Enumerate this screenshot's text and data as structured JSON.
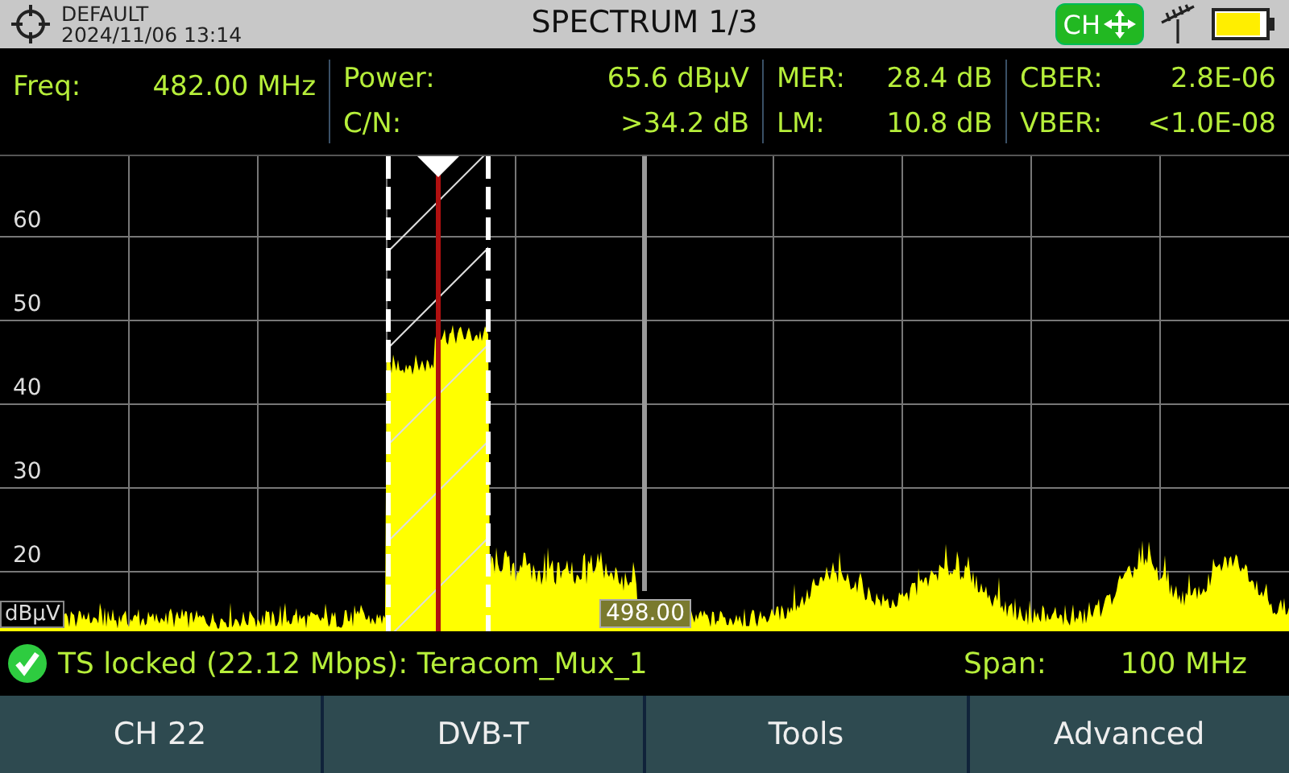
{
  "header": {
    "preset": "DEFAULT",
    "datetime": "2024/11/06 13:14",
    "title": "SPECTRUM 1/3",
    "mode_badge": "CH"
  },
  "measurements": [
    [
      {
        "label": "Freq:",
        "value": "482.00 MHz"
      }
    ],
    [
      {
        "label": "Power:",
        "value": "65.6 dBµV"
      },
      {
        "label": "C/N:",
        "value": ">34.2 dB"
      }
    ],
    [
      {
        "label": "MER:",
        "value": "28.4 dB"
      },
      {
        "label": "LM:",
        "value": "10.8 dB"
      }
    ],
    [
      {
        "label": "CBER:",
        "value": "2.8E-06"
      },
      {
        "label": "VBER:",
        "value": "<1.0E-08"
      }
    ]
  ],
  "chart": {
    "y_labels": [
      "60",
      "50",
      "40",
      "30",
      "20"
    ],
    "unit": "dBµV",
    "marker_label": "498.00"
  },
  "status": {
    "locked": true,
    "message": "TS locked (22.12 Mbps): Teracom_Mux_1",
    "span_label": "Span:",
    "span_value": "100 MHz"
  },
  "softkeys": [
    "CH 22",
    "DVB-T",
    "Tools",
    "Advanced"
  ]
}
